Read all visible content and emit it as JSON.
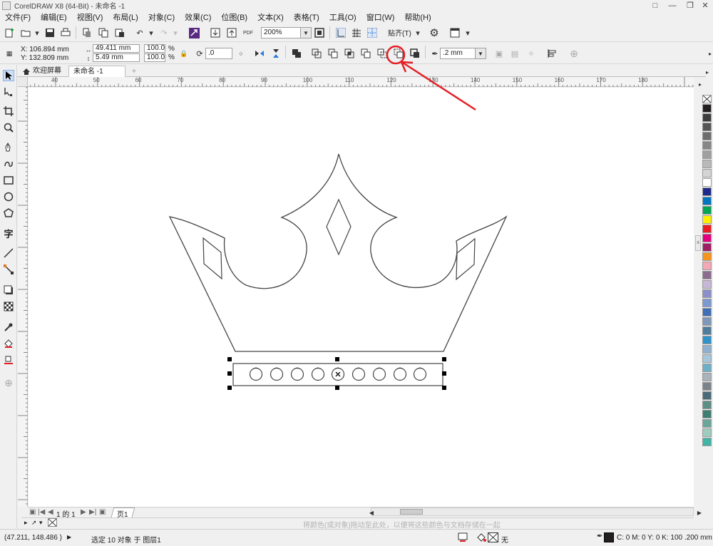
{
  "window": {
    "title": "CorelDRAW X8 (64-Bit) - 未命名 -1"
  },
  "menu": [
    "文件(F)",
    "编辑(E)",
    "视图(V)",
    "布局(L)",
    "对象(C)",
    "效果(C)",
    "位图(B)",
    "文本(X)",
    "表格(T)",
    "工具(O)",
    "窗口(W)",
    "帮助(H)"
  ],
  "toolbar": {
    "zoom": "200%",
    "snap_label": "贴齐(T)"
  },
  "property_bar": {
    "x": "X: 106.894 mm",
    "y": "Y: 132.809 mm",
    "width": "49.411 mm",
    "height": "5.49 mm",
    "scale_x": "100.0",
    "scale_y": "100.0",
    "percent": "%",
    "rotation": ".0",
    "outline_width": ".2 mm"
  },
  "doc_tabs": {
    "home": "欢迎屏幕",
    "active": "未命名 -1"
  },
  "ruler": {
    "top_ticks": [
      "40",
      "50",
      "60",
      "70",
      "80",
      "90",
      "100",
      "110",
      "120",
      "130",
      "140",
      "150",
      "160",
      "170",
      "180"
    ]
  },
  "page_nav": {
    "page_of": "1 的 1",
    "page_tab": "页1"
  },
  "palette_hint": "将颜色(或对象)拖动至此处，以便将这些颜色与文档存储在一起",
  "status": {
    "coords": "(47.211, 148.486 )",
    "selection": "选定 10 对象 于 图层1",
    "fill_none": "无",
    "outline_info": "C: 0 M: 0 Y: 0 K: 100  .200 mm"
  },
  "palette_colors": [
    "#231f20",
    "#3d3d3d",
    "#555555",
    "#6e6e6e",
    "#878787",
    "#a0a0a0",
    "#b9b9b9",
    "#d4d4d4",
    "#ffffff",
    "#1d2a8c",
    "#0076c0",
    "#00a651",
    "#ffef00",
    "#ed1c24",
    "#e4007f",
    "#9e1f63",
    "#f7941d",
    "#f4a8b5",
    "#8c6d8f",
    "#c7b6d6",
    "#8c8fc9",
    "#7c99d3",
    "#3f6fb6",
    "#7f97b9",
    "#4e7c9c",
    "#2f92c8",
    "#8fb1cf",
    "#a6c7d9",
    "#6dafc7",
    "#a9b3b9",
    "#7a838a",
    "#4b6a78",
    "#5c8f85",
    "#3f7f73",
    "#6aa69a",
    "#9ecdbf",
    "#40b5a6"
  ],
  "colors": {
    "annotation_red": "#e41f26",
    "canvas": "#ffffff",
    "chrome": "#f0f0f0"
  }
}
